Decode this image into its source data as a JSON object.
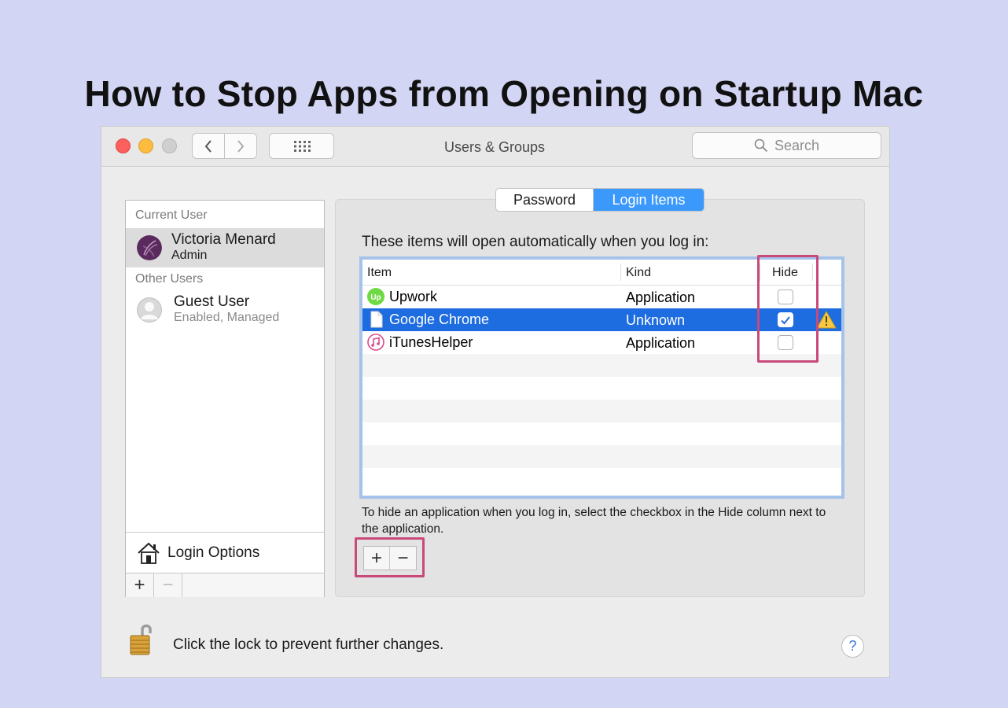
{
  "headline": "How to Stop Apps from Opening on Startup Mac",
  "window": {
    "title": "Users & Groups",
    "search_placeholder": "Search"
  },
  "users": {
    "current_label": "Current User",
    "current": {
      "name": "Victoria Menard",
      "role": "Admin"
    },
    "other_label": "Other Users",
    "others": [
      {
        "name": "Guest User",
        "role": "Enabled, Managed"
      }
    ],
    "login_options": "Login Options",
    "add": "+",
    "remove": "−"
  },
  "tabs": [
    "Password",
    "Login Items"
  ],
  "active_tab": "Login Items",
  "login_items": {
    "intro": "These items will open automatically when you log in:",
    "columns": {
      "item": "Item",
      "kind": "Kind",
      "hide": "Hide"
    },
    "rows": [
      {
        "name": "Upwork",
        "kind": "Application",
        "hide": false,
        "icon": "upwork-icon"
      },
      {
        "name": "Google Chrome",
        "kind": "Unknown",
        "hide": true,
        "icon": "document-icon",
        "selected": true,
        "warning": true
      },
      {
        "name": "iTunesHelper",
        "kind": "Application",
        "hide": false,
        "icon": "itunes-icon"
      }
    ],
    "hint": "To hide an application when you log in, select the checkbox in the Hide column next to the application.",
    "add": "+",
    "remove": "−"
  },
  "footer": {
    "lock_text": "Click the lock to prevent further changes.",
    "help": "?"
  },
  "colors": {
    "background": "#d3d5f4",
    "highlight": "#c9497a",
    "selection": "#1d6ce0",
    "tab_active": "#3b99fc"
  }
}
